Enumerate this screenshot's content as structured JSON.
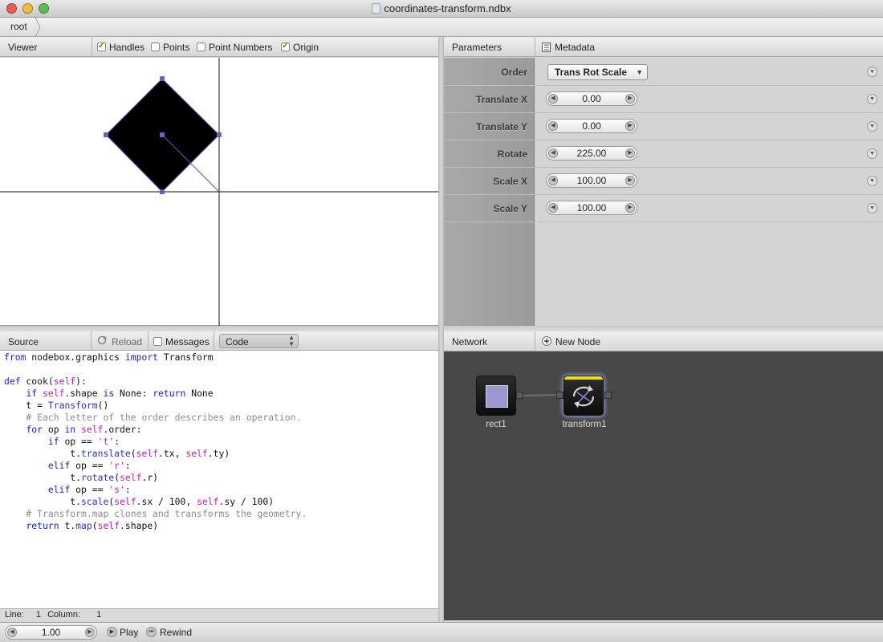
{
  "window": {
    "title": "coordinates-transform.ndbx",
    "traffic_lights": {
      "close": "#ef5b52",
      "minimize": "#f5bd3a",
      "zoom": "#5ac24c"
    }
  },
  "path_bar": {
    "crumb": "root"
  },
  "viewer": {
    "title": "Viewer",
    "options": [
      {
        "label": "Handles",
        "checked": true
      },
      {
        "label": "Points",
        "checked": false
      },
      {
        "label": "Point Numbers",
        "checked": false
      },
      {
        "label": "Origin",
        "checked": true
      }
    ]
  },
  "parameters": {
    "tab_parameters": "Parameters",
    "tab_metadata": "Metadata",
    "order": {
      "label": "Order",
      "value": "Trans Rot Scale"
    },
    "rows": [
      {
        "label": "Translate X",
        "value": "0.00"
      },
      {
        "label": "Translate Y",
        "value": "0.00"
      },
      {
        "label": "Rotate",
        "value": "225.00"
      },
      {
        "label": "Scale X",
        "value": "100.00"
      },
      {
        "label": "Scale Y",
        "value": "100.00"
      }
    ]
  },
  "source": {
    "title": "Source",
    "reload": "Reload",
    "messages": "Messages",
    "messages_checked": false,
    "mode": "Code",
    "code_lines": [
      "from nodebox.graphics import Transform",
      "",
      "def cook(self):",
      "    if self.shape is None: return None",
      "    t = Transform()",
      "    # Each letter of the order describes an operation.",
      "    for op in self.order:",
      "        if op == 't':",
      "            t.translate(self.tx, self.ty)",
      "        elif op == 'r':",
      "            t.rotate(self.r)",
      "        elif op == 's':",
      "            t.scale(self.sx / 100, self.sy / 100)",
      "    # Transform.map clones and transforms the geometry.",
      "    return t.map(self.shape)"
    ],
    "status": {
      "line_label": "Line:",
      "line": "1",
      "column_label": "Column:",
      "column": "1"
    }
  },
  "network": {
    "title": "Network",
    "new_node": "New Node",
    "nodes": [
      {
        "name": "rect1",
        "icon": "rect-node-icon",
        "rendered": false
      },
      {
        "name": "transform1",
        "icon": "transform-node-icon",
        "rendered": true
      }
    ],
    "rendered_color": "#e8e600"
  },
  "playback": {
    "frame": "1.00",
    "play": "Play",
    "rewind": "Rewind"
  }
}
